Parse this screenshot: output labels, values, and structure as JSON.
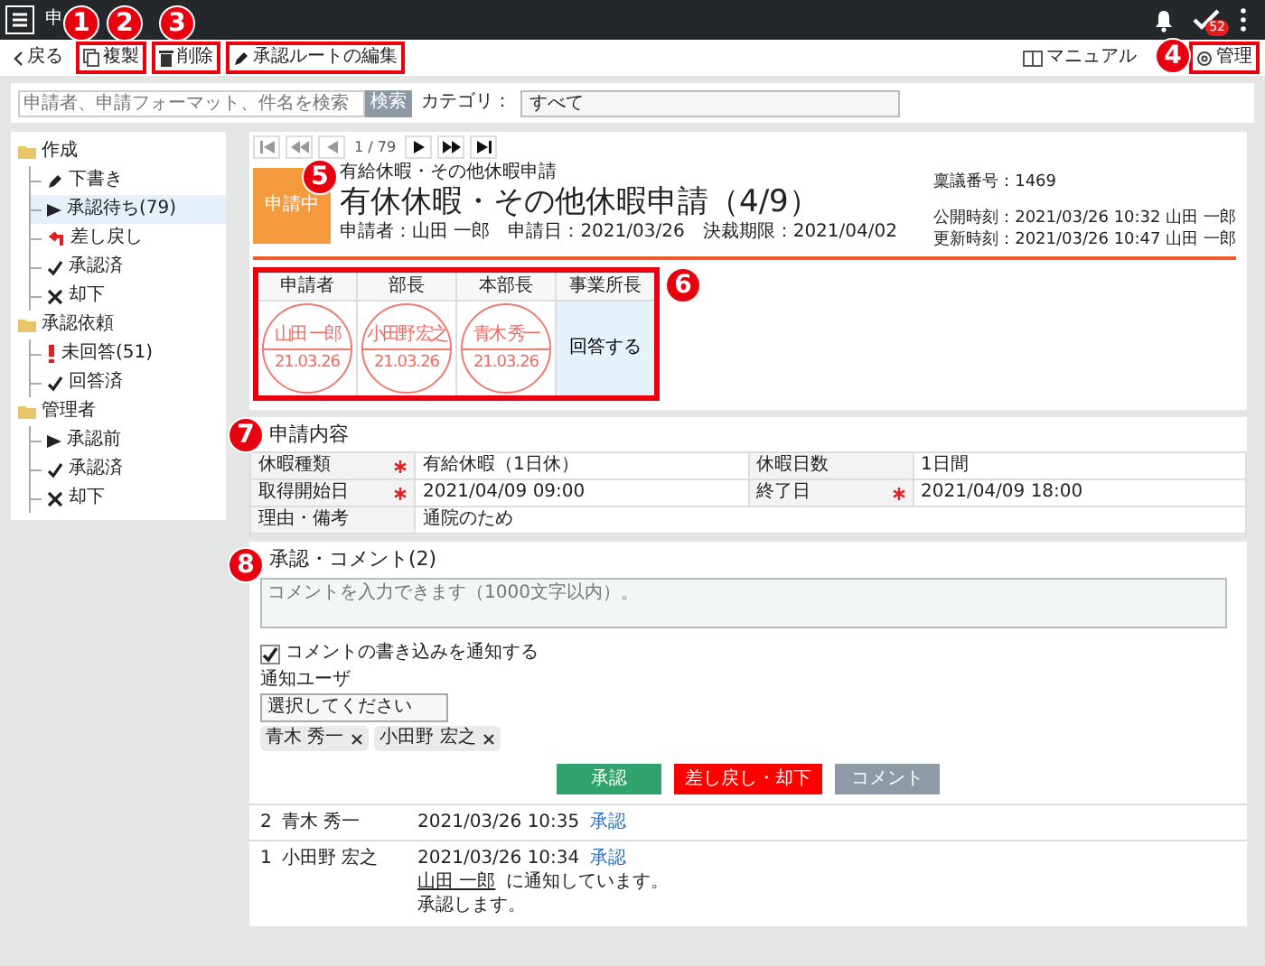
{
  "topbar": {
    "title": "申",
    "badge": "52"
  },
  "toolbar": {
    "back": "戻る",
    "actions": [
      {
        "label": "複製",
        "kind": "copy"
      },
      {
        "label": "削除",
        "kind": "delete"
      },
      {
        "label": "承認ルートの編集",
        "kind": "edit"
      }
    ],
    "manual": "マニュアル",
    "admin": "管理"
  },
  "search": {
    "placeholder": "申請者、申請フォーマット、件名を検索",
    "button": "検索",
    "category_label": "カテゴリ：",
    "category": "すべて"
  },
  "sidebar": [
    {
      "label": "作成",
      "children": [
        {
          "label": "下書き",
          "kind": "draft",
          "selected": false
        },
        {
          "label": "承認待ち(79)",
          "kind": "waiting",
          "selected": true
        },
        {
          "label": "差し戻し",
          "kind": "returned",
          "selected": false
        },
        {
          "label": "承認済",
          "kind": "done",
          "selected": false
        },
        {
          "label": "却下",
          "kind": "rejected",
          "selected": false
        }
      ]
    },
    {
      "label": "承認依頼",
      "children": [
        {
          "label": "未回答(51)",
          "kind": "unanswered",
          "selected": false
        },
        {
          "label": "回答済",
          "kind": "done",
          "selected": false
        }
      ]
    },
    {
      "label": "管理者",
      "children": [
        {
          "label": "承認前",
          "kind": "waiting",
          "selected": false
        },
        {
          "label": "承認済",
          "kind": "done",
          "selected": false
        },
        {
          "label": "却下",
          "kind": "rejected",
          "selected": false
        }
      ]
    }
  ],
  "pager": {
    "position": "1 / 79"
  },
  "request": {
    "status": "申請中",
    "form": "有給休暇・その他休暇申請",
    "title": "有休休暇・その他休暇申請（4/9）",
    "meta": [
      "申請者：山田 一郎",
      "申請日：2021/03/26",
      "決裁期限：2021/04/02"
    ],
    "number": "稟議番号：1469",
    "published": "公開時刻：2021/03/26 10:32 山田 一郎",
    "updated": "更新時刻：2021/03/26 10:47 山田 一郎"
  },
  "approvals": [
    {
      "role": "申請者",
      "kind": "stamp",
      "name": "山田 一郎",
      "date": "21.03.26"
    },
    {
      "role": "部長",
      "kind": "stamp",
      "name": "小田野 宏之",
      "date": "21.03.26"
    },
    {
      "role": "本部長",
      "kind": "stamp",
      "name": "青木 秀一",
      "date": "21.03.26"
    },
    {
      "role": "事業所長",
      "kind": "pending",
      "action": "回答する"
    }
  ],
  "content": {
    "title": "申請内容",
    "rows": [
      [
        {
          "label": "休暇種類",
          "required": true,
          "value": "有給休暇（1日休）"
        },
        {
          "label": "休暇日数",
          "required": false,
          "value": "1日間"
        }
      ],
      [
        {
          "label": "取得開始日",
          "required": true,
          "value": "2021/04/09 09:00"
        },
        {
          "label": "終了日",
          "required": true,
          "value": "2021/04/09 18:00"
        }
      ],
      [
        {
          "label": "理由・備考",
          "required": false,
          "value": "通院のため"
        }
      ]
    ]
  },
  "comments": {
    "title": "承認・コメント(2)",
    "placeholder": "コメントを入力できます（1000文字以内）。",
    "notify": {
      "label": "コメントの書き込みを通知する",
      "checked": true
    },
    "user_label": "通知ユーザ",
    "select_placeholder": "選択してください",
    "tags": [
      "青木 秀一",
      "小田野 宏之"
    ],
    "buttons": [
      {
        "label": "承認",
        "kind": "approve"
      },
      {
        "label": "差し戻し・却下",
        "kind": "reject"
      },
      {
        "label": "コメント",
        "kind": "comment"
      }
    ],
    "history": [
      {
        "no": "2",
        "name": "青木 秀一",
        "time": "2021/03/26 10:35",
        "action": "承認"
      },
      {
        "no": "1",
        "name": "小田野 宏之",
        "time": "2021/03/26 10:34",
        "action": "承認",
        "mention": "山田 一郎",
        "mention_text": "に通知しています。",
        "lines": [
          "承認します。"
        ]
      }
    ]
  },
  "callouts": [
    "1",
    "2",
    "3",
    "4",
    "5",
    "6",
    "7",
    "8"
  ]
}
